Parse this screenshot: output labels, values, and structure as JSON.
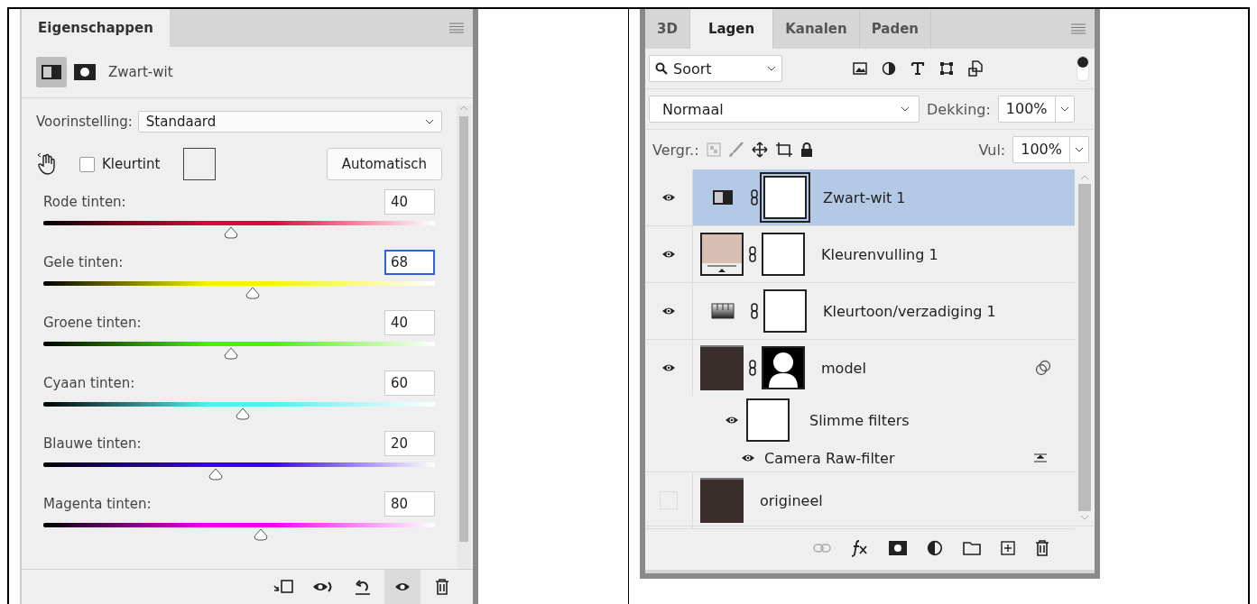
{
  "properties": {
    "title": "Eigenschappen",
    "adjustment": "Zwart-wit",
    "preset": {
      "label": "Voorinstelling:",
      "value": "Standaard"
    },
    "tint": {
      "label": "Kleurtint",
      "checked": false
    },
    "auto_button": "Automatisch",
    "sliders": [
      {
        "label": "Rode tinten:",
        "value": "40",
        "level": 0.48,
        "color": "#e8003a",
        "focused": false
      },
      {
        "label": "Gele tinten:",
        "value": "68",
        "level": 0.535,
        "color": "#f4f400",
        "focused": true
      },
      {
        "label": "Groene tinten:",
        "value": "40",
        "level": 0.48,
        "color": "#4cf000",
        "focused": false
      },
      {
        "label": "Cyaan tinten:",
        "value": "60",
        "level": 0.51,
        "color": "#50f0f0",
        "focused": false
      },
      {
        "label": "Blauwe tinten:",
        "value": "20",
        "level": 0.44,
        "color": "#3a00f0",
        "focused": false
      },
      {
        "label": "Magenta tinten:",
        "value": "80",
        "level": 0.555,
        "color": "#f000f0",
        "focused": false
      }
    ],
    "footer_buttons": [
      {
        "kind": "clip",
        "on": false
      },
      {
        "kind": "view-previous",
        "on": false
      },
      {
        "kind": "reset",
        "on": false
      },
      {
        "kind": "visibility",
        "on": true
      },
      {
        "kind": "delete",
        "on": false
      }
    ]
  },
  "layers_panel": {
    "tabs": [
      {
        "label": "3D",
        "selected": false
      },
      {
        "label": "Lagen",
        "selected": true
      },
      {
        "label": "Kanalen",
        "selected": false
      },
      {
        "label": "Paden",
        "selected": false
      }
    ],
    "filter": "Soort",
    "blend_mode": "Normaal",
    "opacity": {
      "label": "Dekking:",
      "value": "100%"
    },
    "lock_label": "Vergr.:",
    "fill": {
      "label": "Vul:",
      "value": "100%"
    },
    "layers": [
      {
        "kind": "black-white",
        "name": "Zwart-wit 1",
        "visible": true,
        "selected": true
      },
      {
        "kind": "color-fill",
        "name": "Kleurenvulling 1",
        "visible": true,
        "selected": false
      },
      {
        "kind": "hue-saturation",
        "name": "Kleurtoon/verzadiging 1",
        "visible": true,
        "selected": false
      },
      {
        "kind": "smart-object",
        "name": "model",
        "visible": true,
        "selected": false,
        "smart_filters": {
          "label": "Slimme filters",
          "visible": true,
          "filters": [
            {
              "name": "Camera Raw-filter",
              "visible": true
            }
          ]
        }
      },
      {
        "kind": "pixel",
        "name": "origineel",
        "visible": false,
        "selected": false
      }
    ]
  }
}
